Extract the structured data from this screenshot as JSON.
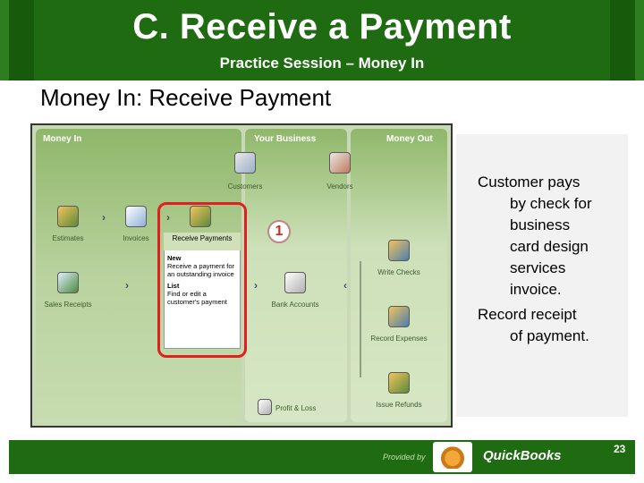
{
  "header": {
    "title": "C. Receive a Payment",
    "subtitle": "Practice Session – Money In"
  },
  "slide": {
    "heading": "Money In: Receive Payment"
  },
  "quickbooks": {
    "columns": {
      "money_in": "Money In",
      "your_business": "Your Business",
      "money_out": "Money Out"
    },
    "icons": {
      "customers": "Customers",
      "vendors": "Vendors",
      "estimates": "Estimates",
      "invoices": "Invoices",
      "receive_payments": "Receive Payments",
      "sales_receipts": "Sales Receipts",
      "bank_accounts": "Bank Accounts",
      "write_checks": "Write Checks",
      "record_expenses": "Record Expenses",
      "issue_refunds": "Issue Refunds",
      "profit_loss": "Profit & Loss"
    },
    "popup": {
      "new_label": "New",
      "new_text": "Receive a payment for an outstanding invoice",
      "list_label": "List",
      "list_text": "Find or edit a customer's payment"
    },
    "step_badge": "1"
  },
  "instructions": {
    "line1_first": "Customer pays",
    "line1_rest": [
      "by check for",
      "business",
      "card design",
      "services",
      "invoice."
    ],
    "line2_first": "Record receipt",
    "line2_rest": [
      "of payment."
    ]
  },
  "footer": {
    "provided_by": "Provided by",
    "brand": "QuickBooks",
    "page_number": "23"
  },
  "colors": {
    "header_green": "#1f6b12",
    "highlight_red": "#e0201e",
    "badge_red": "#d62a1a"
  }
}
